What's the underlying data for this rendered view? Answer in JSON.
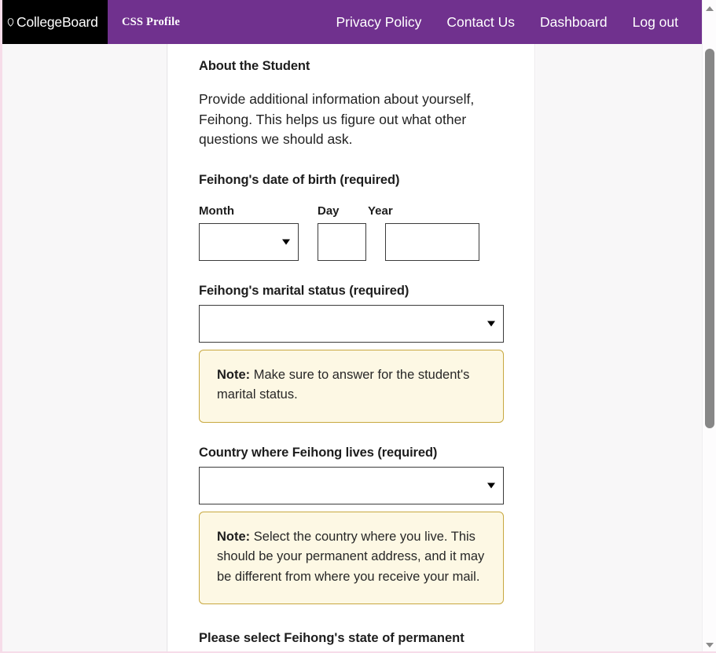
{
  "navbar": {
    "logo_text": "CollegeBoard",
    "logo_icon": "acorn-icon",
    "brand": "CSS Profile",
    "links": [
      {
        "label": "Privacy Policy"
      },
      {
        "label": "Contact Us"
      },
      {
        "label": "Dashboard"
      },
      {
        "label": "Log out"
      }
    ],
    "background_color": "#70318E",
    "logo_background_color": "#000000"
  },
  "main": {
    "section_title": "About the Student",
    "intro": "Provide additional information about yourself, Feihong. This helps us figure out what other questions we should ask.",
    "dob": {
      "label": "Feihong's date of birth (required)",
      "month_label": "Month",
      "day_label": "Day",
      "year_label": "Year",
      "month_value": "",
      "day_value": "",
      "year_value": "",
      "month_placeholder": "",
      "day_placeholder": "",
      "year_placeholder": ""
    },
    "marital": {
      "label": "Feihong's marital status (required)",
      "value": "",
      "note_label": "Note:",
      "note_text": " Make sure to answer for the student's marital status."
    },
    "country": {
      "label": "Country where Feihong lives (required)",
      "value": "",
      "note_label": "Note:",
      "note_text": " Select the country where you live. This should be your permanent address, and it may be different from where you receive your mail."
    },
    "next_question_partial": "Please select Feihong's state of permanent"
  },
  "note_style": {
    "background_color": "#FDF8E4",
    "border_color": "#C8A83F"
  },
  "scrollbar": {
    "up_icon": "chevron-up-icon",
    "down_icon": "chevron-down-icon"
  }
}
